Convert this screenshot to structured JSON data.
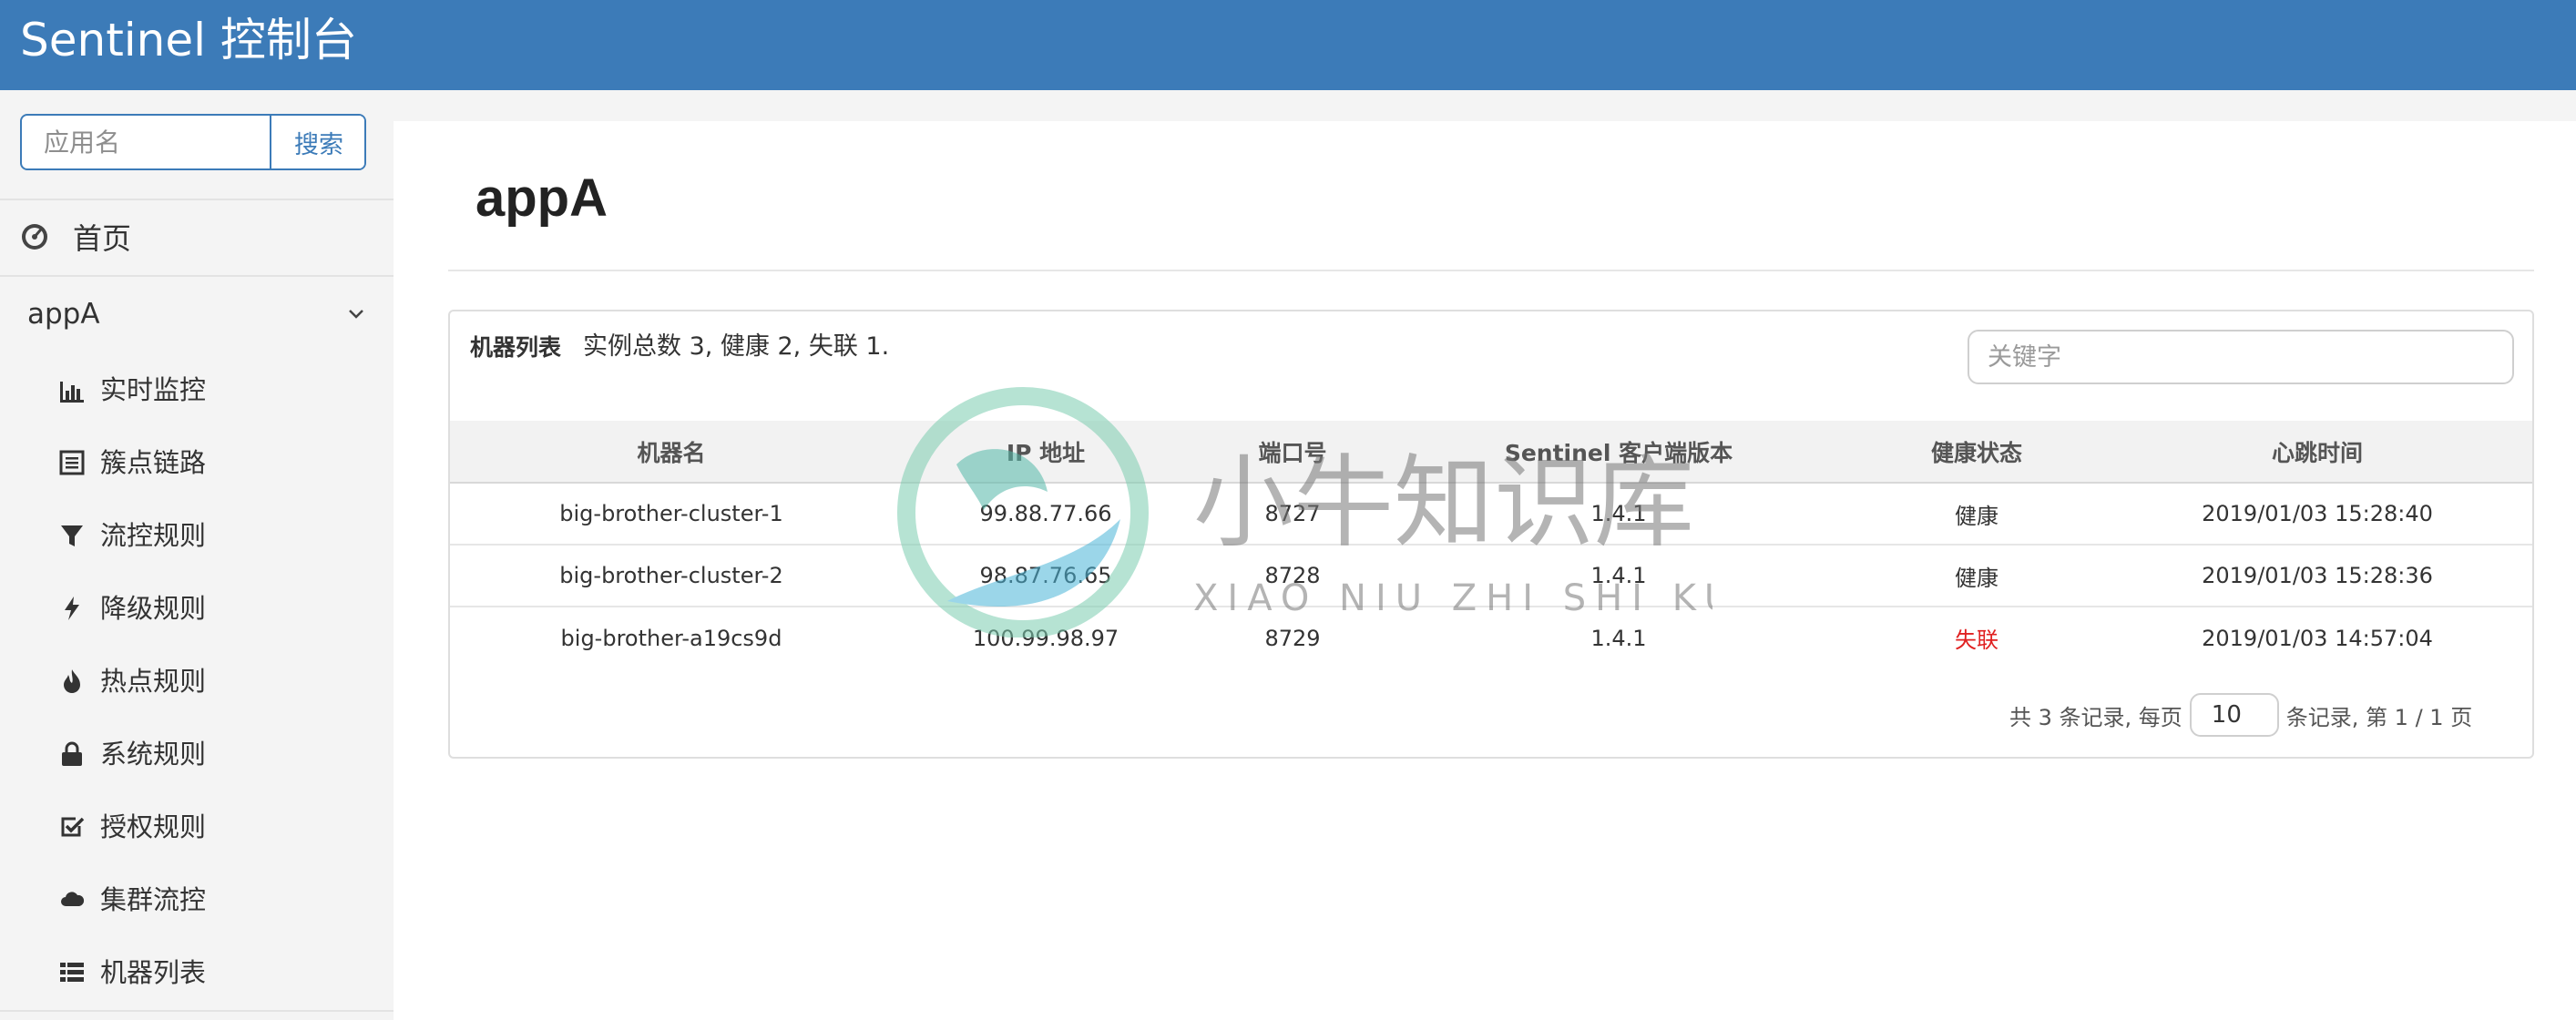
{
  "app": {
    "title": "Sentinel 控制台"
  },
  "sidebar": {
    "search": {
      "placeholder": "应用名",
      "button": "搜索"
    },
    "home": {
      "label": "首页",
      "icon": "dashboard-icon"
    },
    "app_group": {
      "label": "appA",
      "icon": "chevron-down-icon"
    },
    "items": [
      {
        "label": "实时监控",
        "icon": "bar-chart-icon"
      },
      {
        "label": "簇点链路",
        "icon": "list-alt-icon"
      },
      {
        "label": "流控规则",
        "icon": "filter-icon"
      },
      {
        "label": "降级规则",
        "icon": "flash-icon"
      },
      {
        "label": "热点规则",
        "icon": "fire-icon"
      },
      {
        "label": "系统规则",
        "icon": "lock-icon"
      },
      {
        "label": "授权规则",
        "icon": "check-icon"
      },
      {
        "label": "集群流控",
        "icon": "cloud-icon"
      },
      {
        "label": "机器列表",
        "icon": "list-icon"
      }
    ]
  },
  "main": {
    "page_title": "appA",
    "panel": {
      "title": "机器列表",
      "summary": "实例总数 3, 健康 2, 失联 1.",
      "keyword_placeholder": "关键字"
    },
    "table": {
      "headers": [
        "机器名",
        "IP 地址",
        "端口号",
        "Sentinel 客户端版本",
        "健康状态",
        "心跳时间"
      ],
      "rows": [
        {
          "name": "big-brother-cluster-1",
          "ip": "99.88.77.66",
          "port": "8727",
          "version": "1.4.1",
          "status": "健康",
          "heartbeat": "2019/01/03 15:28:40"
        },
        {
          "name": "big-brother-cluster-2",
          "ip": "98.87.76.65",
          "port": "8728",
          "version": "1.4.1",
          "status": "健康",
          "heartbeat": "2019/01/03 15:28:36"
        },
        {
          "name": "big-brother-a19cs9d",
          "ip": "100.99.98.97",
          "port": "8729",
          "version": "1.4.1",
          "status": "失联",
          "heartbeat": "2019/01/03 14:57:04"
        }
      ]
    },
    "pager": {
      "prefix": "共 3 条记录, 每页",
      "page_size": "10",
      "suffix": "条记录, 第 1 / 1 页"
    }
  },
  "watermark": {
    "text_cn": "小牛知识库",
    "text_en": "XIAO NIU ZHI SHI KU"
  },
  "colors": {
    "header": "#3c7bb8",
    "lost": "#e02020",
    "healthy": "#333333"
  }
}
